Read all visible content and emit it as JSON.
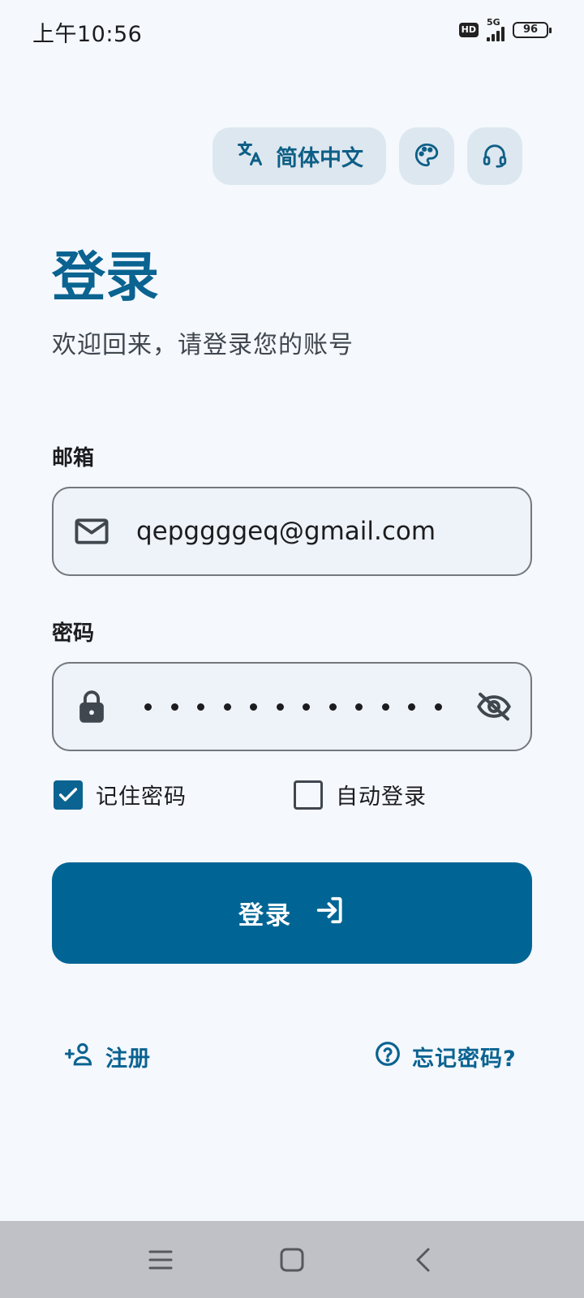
{
  "status_bar": {
    "time": "上午10:56",
    "hd": "HD",
    "network": "5G",
    "battery": "96"
  },
  "top_actions": {
    "language_label": "简体中文",
    "icons": [
      "translate-icon",
      "palette-icon",
      "headset-icon"
    ]
  },
  "header": {
    "title": "登录",
    "subtitle": "欢迎回来，请登录您的账号"
  },
  "email": {
    "label": "邮箱",
    "value": "qepggggeq@gmail.com",
    "icon": "mail-icon"
  },
  "password": {
    "label": "密码",
    "masked_length": 12,
    "icon": "lock-icon",
    "toggle_icon": "eye-off-icon"
  },
  "options": {
    "remember_label": "记住密码",
    "remember_checked": true,
    "auto_login_label": "自动登录",
    "auto_login_checked": false
  },
  "login_button": {
    "label": "登录",
    "icon": "login-icon"
  },
  "links": {
    "register_label": "注册",
    "forgot_label": "忘记密码?"
  },
  "colors": {
    "primary": "#006595",
    "background": "#f5f8fd",
    "chip": "#dde7f0"
  }
}
